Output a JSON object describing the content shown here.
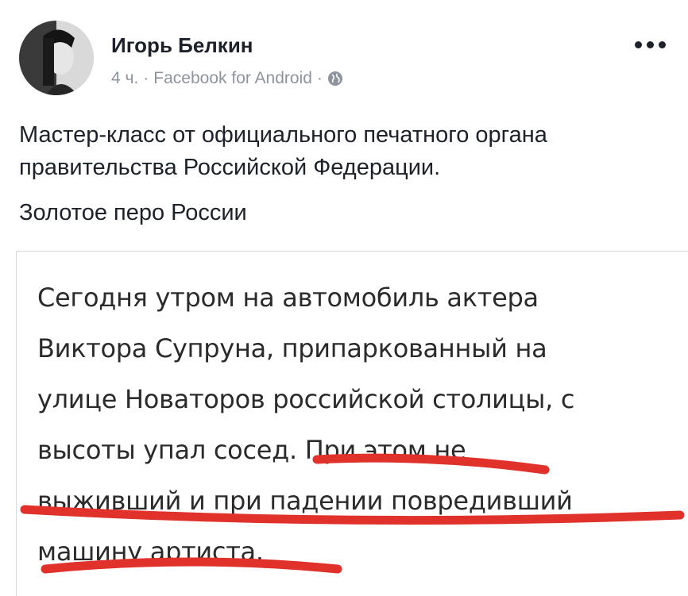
{
  "post": {
    "author": "Игорь Белкин",
    "time": "4 ч.",
    "separator": "·",
    "source": "Facebook for Android",
    "privacy_icon": "globe-icon",
    "more_icon": "ellipsis-icon",
    "text_line1": "Мастер-класс от официального печатного органа",
    "text_line2": "правительства Российской Федерации.",
    "text_signature": "Золотое перо России"
  },
  "image_card": {
    "lines": [
      "Сегодня утром на автомобиль актера",
      "Виктора Супруна, припаркованный на",
      "улице Новаторов российской столицы, с",
      "высоты упал сосед. При этом не",
      "выживший и при падении повредивший",
      "машину артиста."
    ],
    "underline_color": "#e0312b"
  }
}
